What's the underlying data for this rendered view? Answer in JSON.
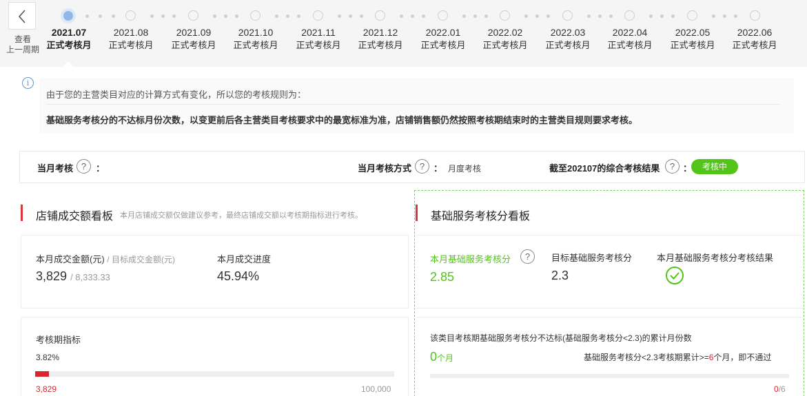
{
  "header": {
    "prev_period_label_1": "查看",
    "prev_period_label_2": "上一周期",
    "months": [
      {
        "date": "2021.07",
        "type": "正式考核月"
      },
      {
        "date": "2021.08",
        "type": "正式考核月"
      },
      {
        "date": "2021.09",
        "type": "正式考核月"
      },
      {
        "date": "2021.10",
        "type": "正式考核月"
      },
      {
        "date": "2021.11",
        "type": "正式考核月"
      },
      {
        "date": "2021.12",
        "type": "正式考核月"
      },
      {
        "date": "2022.01",
        "type": "正式考核月"
      },
      {
        "date": "2022.02",
        "type": "正式考核月"
      },
      {
        "date": "2022.03",
        "type": "正式考核月"
      },
      {
        "date": "2022.04",
        "type": "正式考核月"
      },
      {
        "date": "2022.05",
        "type": "正式考核月"
      },
      {
        "date": "2022.06",
        "type": "正式考核月"
      }
    ],
    "active_month_index": 0
  },
  "notice": {
    "line1": "由于您的主营类目对应的计算方式有变化，所以您的考核规则为：",
    "line2": "基础服务考核分的不达标月份次数，以变更前后各主营类目考核要求中的最宽标准为准，店铺销售额仍然按照考核期结束时的主营类目规则要求考核。"
  },
  "summary": {
    "monthly_label": "当月考核",
    "colon": "：",
    "method_label": "当月考核方式",
    "method_value": "月度考核",
    "result_label": "截至202107的综合考核结果",
    "result_badge": "考核中",
    "badge_color": "#52c41a"
  },
  "left_panel": {
    "title": "店铺成交额看板",
    "subtitle": "本月店铺成交额仅做建议参考，最终店铺成交额以考核期指标进行考核。",
    "amount_label": "本月成交金额(元)",
    "target_label": "/ 目标成交金额(元)",
    "amount_value": "3,829",
    "target_value": "/ 8,333.33",
    "progress_label": "本月成交进度",
    "progress_value": "45.94%",
    "period_label": "考核期指标",
    "period_percent": "3.82%",
    "period_current": "3,829",
    "period_target": "100,000",
    "period_fraction": 0.0382
  },
  "right_panel": {
    "title": "基础服务考核分看板",
    "score_label": "本月基础服务考核分",
    "score_value": "2.85",
    "target_label": "目标基础服务考核分",
    "target_value": "2.3",
    "result_label": "本月基础服务考核分考核结果",
    "result_icon": "check-circle-icon",
    "fail_count_label": "该类目考核期基础服务考核分不达标(基础服务考核分<2.3)的累计月份数",
    "fail_count_value": "0",
    "fail_count_unit": "个月",
    "rule_prefix": "基础服务考核分<2.3考核期累计>=",
    "rule_number": "6",
    "rule_suffix": "个月，即不通过",
    "progress_current": "0",
    "progress_total": "/6",
    "progress_fraction": 0
  },
  "colors": {
    "accent_red": "#d9363e",
    "accent_green": "#52c41a",
    "timeline_active": "#8fb8e8"
  }
}
